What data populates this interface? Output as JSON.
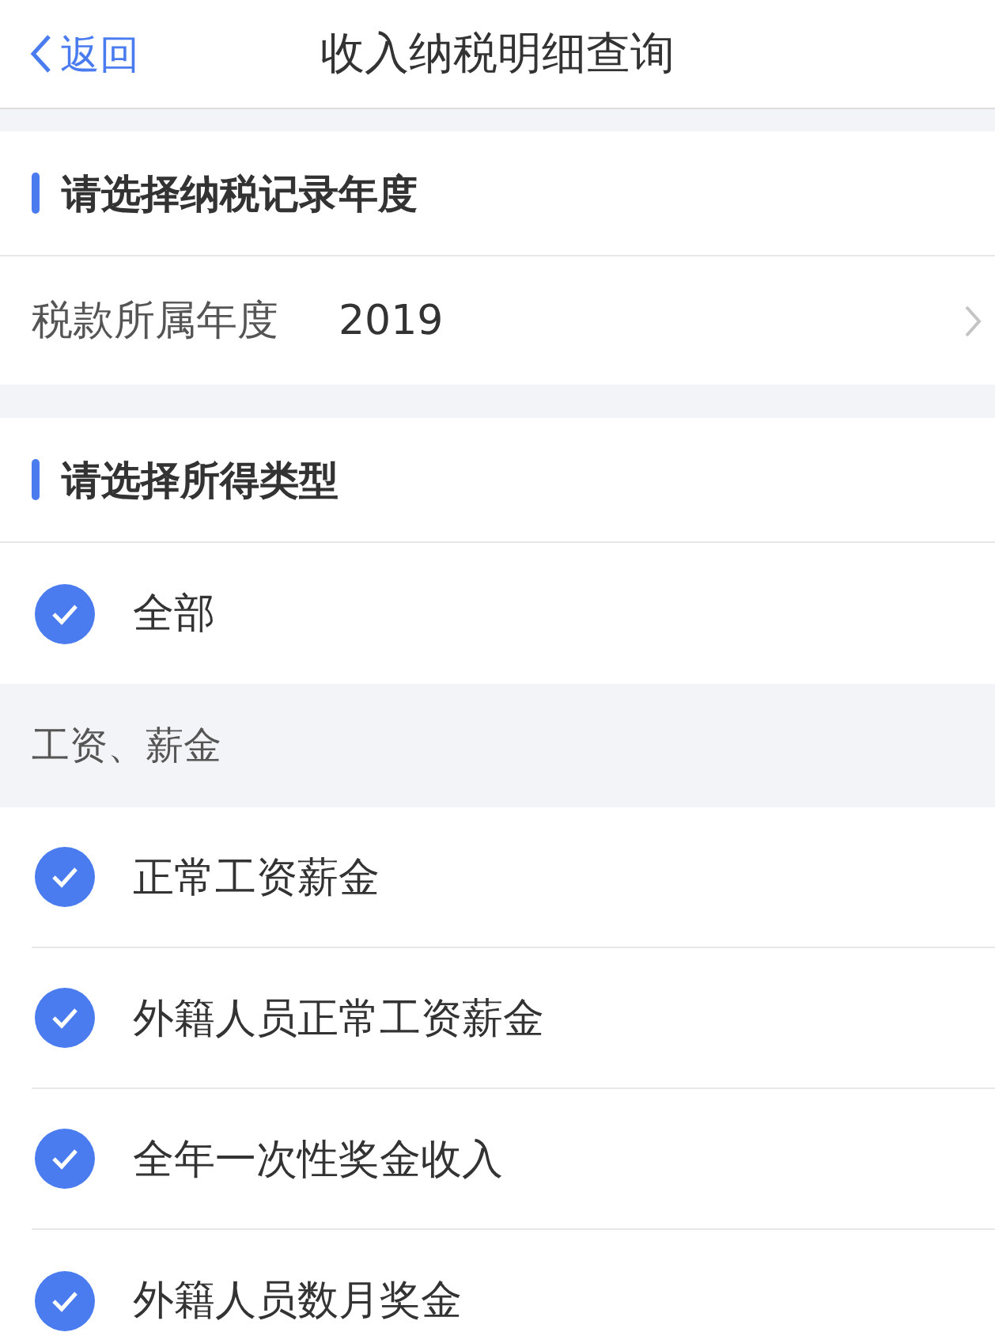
{
  "nav": {
    "back": "返回",
    "title": "收入纳税明细查询"
  },
  "year_section": {
    "heading": "请选择纳税记录年度",
    "field": {
      "label": "税款所属年度",
      "value": "2019"
    }
  },
  "type_section": {
    "heading": "请选择所得类型",
    "items": [
      {
        "kind": "option",
        "label": "全部",
        "checked": true
      },
      {
        "kind": "group",
        "label": "工资、薪金"
      },
      {
        "kind": "option",
        "label": "正常工资薪金",
        "checked": true
      },
      {
        "kind": "option",
        "label": "外籍人员正常工资薪金",
        "checked": true
      },
      {
        "kind": "option",
        "label": "全年一次性奖金收入",
        "checked": true
      },
      {
        "kind": "option",
        "label": "外籍人员数月奖金",
        "checked": true
      }
    ]
  }
}
